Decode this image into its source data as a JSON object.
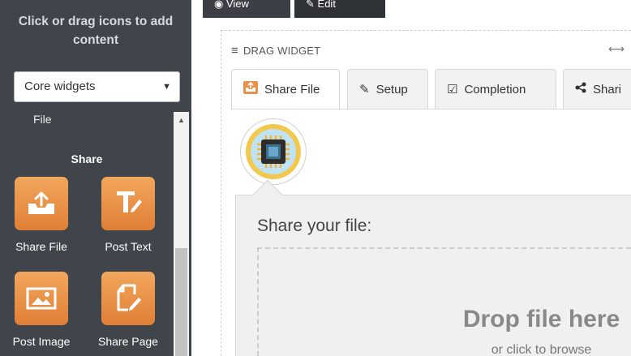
{
  "sidebar": {
    "title": "Click or drag icons to add content",
    "select": {
      "value": "Core widgets"
    },
    "file_label": "File",
    "share_heading": "Share",
    "tiles": [
      {
        "label": "Share File",
        "icon": "upload-tray-icon"
      },
      {
        "label": "Post Text",
        "icon": "text-pen-icon"
      },
      {
        "label": "Post Image",
        "icon": "image-icon"
      },
      {
        "label": "Share Page",
        "icon": "page-pen-icon"
      }
    ]
  },
  "topbar": {
    "tabs": [
      {
        "label": "View"
      },
      {
        "label": "Edit"
      }
    ]
  },
  "widget": {
    "drag_label": "DRAG WIDGET",
    "tabs": [
      {
        "label": "Share File",
        "icon": "share-file-icon",
        "active": true
      },
      {
        "label": "Setup",
        "icon": "pencil-icon"
      },
      {
        "label": "Completion",
        "icon": "check-square-icon"
      },
      {
        "label": "Shari",
        "icon": "share-nodes-icon"
      }
    ],
    "share_title": "Share your file:",
    "drop_main": "Drop file here",
    "drop_sub": "or click to browse"
  },
  "colors": {
    "sidebar_bg": "#3f454b",
    "tile_orange": "#e8914a",
    "dark_tab": "#3c4046"
  }
}
